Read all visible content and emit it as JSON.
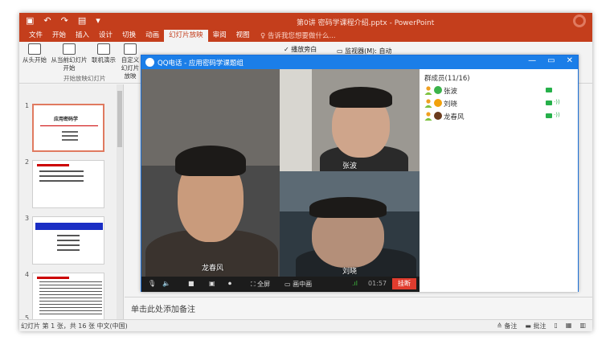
{
  "powerpoint": {
    "title": "第0讲 密码学课程介绍.pptx - PowerPoint",
    "tabs": [
      "文件",
      "开始",
      "插入",
      "设计",
      "切换",
      "动画",
      "幻灯片放映",
      "审阅",
      "视图"
    ],
    "active_tab": "幻灯片放映",
    "tell_me": "告诉我您想要做什么...",
    "ribbon": {
      "from_beginning": "从头开始",
      "from_current": "从当前幻灯片开始",
      "online_present": "联机演示",
      "custom": "自定义幻灯片放映",
      "group_label": "开始放映幻灯片",
      "use_presenter_view": "播放旁白",
      "monitor": "监视器(M): 自动"
    },
    "slides": [
      {
        "num": "1",
        "title": "应用密码学"
      },
      {
        "num": "2",
        "title": "一、课程基本信息"
      },
      {
        "num": "3",
        "title": "三、课程内容安排"
      },
      {
        "num": "4",
        "title": "四、学习要求"
      },
      {
        "num": "5",
        "title": ""
      }
    ],
    "notes_placeholder": "单击此处添加备注",
    "status_left": "幻灯片 第 1 张，共 16 张   中文(中国)",
    "status_notes": "备注",
    "status_comments": "批注"
  },
  "qq": {
    "window_title": "QQ电话 - 应用密码学课题组",
    "members_header": "群成员(11/16)",
    "members": [
      {
        "name": "张波",
        "avatar_color": "#3bb34a"
      },
      {
        "name": "刘晓",
        "avatar_color": "#f2a20c"
      },
      {
        "name": "龙春风",
        "avatar_color": "#6b3c1e"
      }
    ],
    "tiles": {
      "main_label": "龙春风",
      "top_right_label": "张波",
      "bottom_right_label": "刘晓"
    },
    "toolbar": {
      "fullscreen": "全屏",
      "split": "画中画",
      "timer": "01:57",
      "hangup": "挂断"
    }
  },
  "colors": {
    "ppt_accent": "#c43e1c",
    "qq_blue": "#1b7ee8",
    "hangup_red": "#e03c2e"
  }
}
